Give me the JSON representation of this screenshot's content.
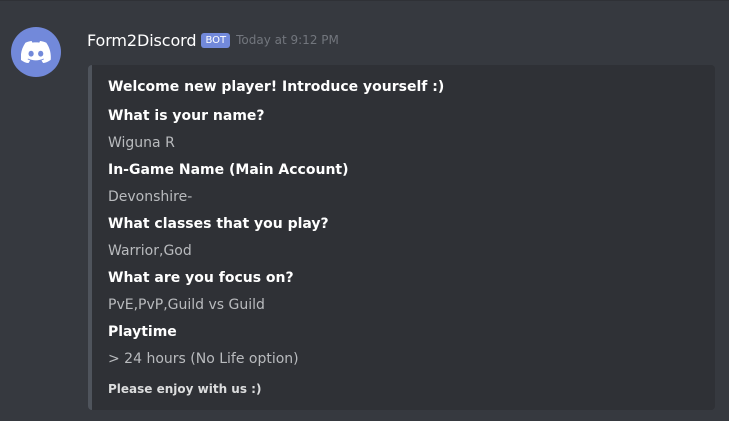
{
  "message": {
    "author": "Form2Discord",
    "bot_tag": "BOT",
    "timestamp": "Today at 9:12 PM",
    "avatar_icon": "discord-logo-icon",
    "colors": {
      "background": "#36393f",
      "embed_background": "#2f3136",
      "embed_border": "#4f545c",
      "blurple": "#7289da"
    }
  },
  "embed": {
    "title": "Welcome new player! Introduce yourself :)",
    "fields": [
      {
        "name": "What is your name?",
        "value": "Wiguna R"
      },
      {
        "name": "In-Game Name (Main Account)",
        "value": "Devonshire-"
      },
      {
        "name": "What classes that you play?",
        "value": "Warrior,God"
      },
      {
        "name": "What are you focus on?",
        "value": "PvE,PvP,Guild vs Guild"
      },
      {
        "name": "Playtime",
        "value": "> 24 hours (No Life option)"
      }
    ],
    "footer": "Please enjoy with us :)"
  }
}
